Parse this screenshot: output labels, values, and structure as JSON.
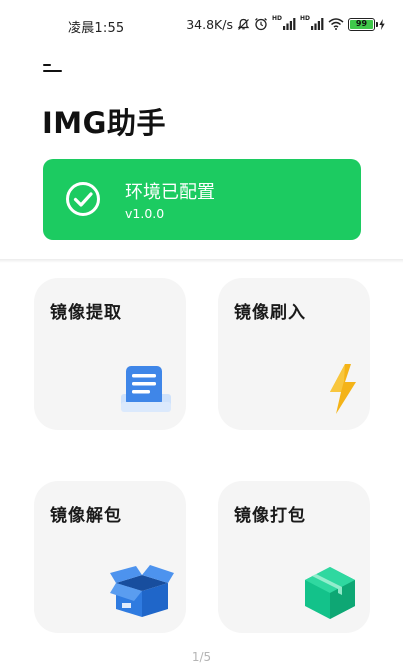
{
  "status_bar": {
    "time": "凌晨1:55",
    "net_speed": "34.8K/s",
    "battery_level": "99",
    "signal_hd_labels": [
      "HD",
      "HD"
    ]
  },
  "header": {
    "title": "IMG助手"
  },
  "env_card": {
    "title": "环境已配置",
    "version": "v1.0.0",
    "color": "#1ccb61"
  },
  "tiles": [
    {
      "label": "镜像提取",
      "icon": "extract-tray-icon"
    },
    {
      "label": "镜像刷入",
      "icon": "lightning-icon"
    },
    {
      "label": "镜像解包",
      "icon": "open-box-icon"
    },
    {
      "label": "镜像打包",
      "icon": "package-icon"
    }
  ],
  "pager": {
    "text": "1/5"
  }
}
